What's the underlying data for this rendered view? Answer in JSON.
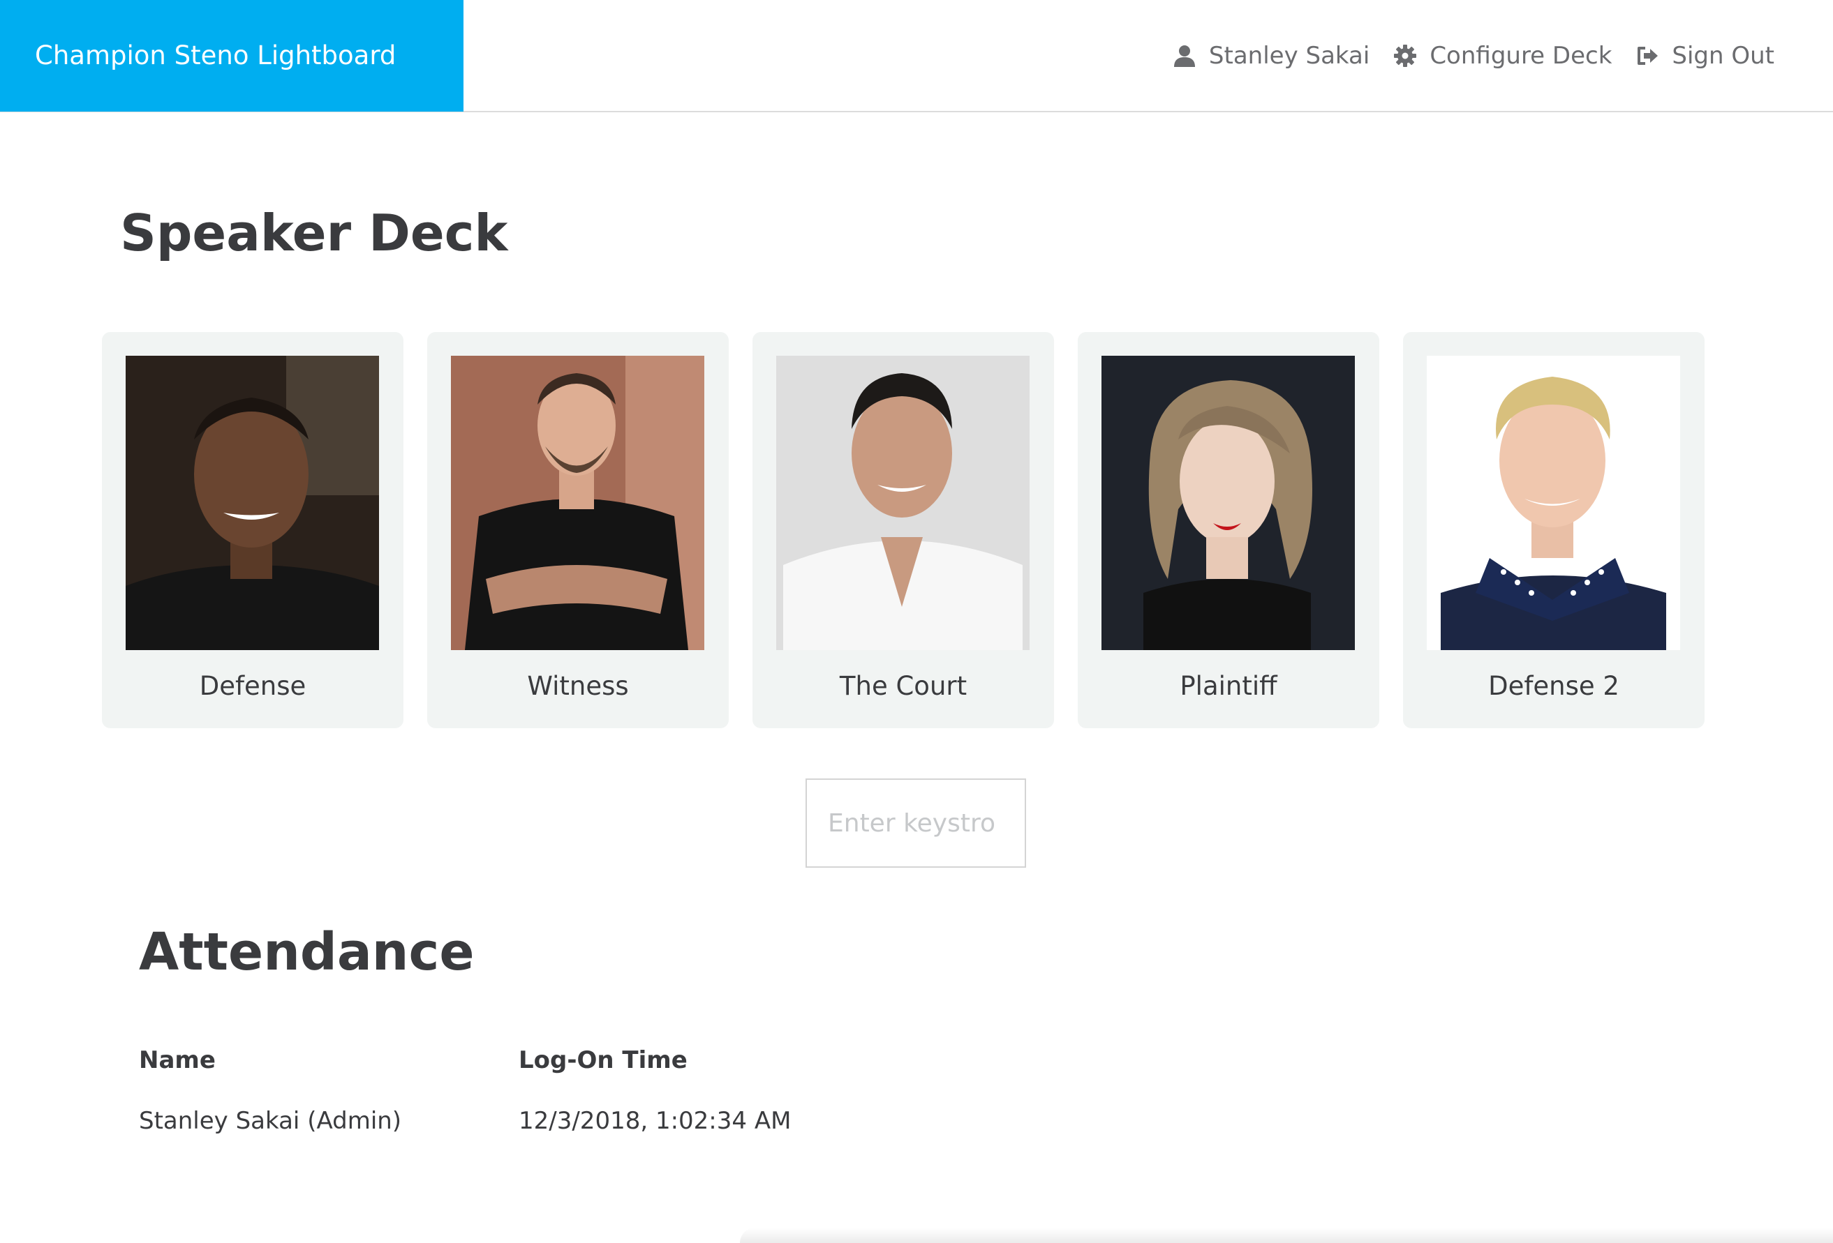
{
  "header": {
    "brand": "Champion Steno Lightboard",
    "brand_color": "#00aef0",
    "nav": [
      {
        "icon": "user-icon",
        "label": "Stanley Sakai"
      },
      {
        "icon": "gear-icon",
        "label": "Configure Deck"
      },
      {
        "icon": "sign-out-icon",
        "label": "Sign Out"
      }
    ]
  },
  "speaker_deck": {
    "title": "Speaker Deck",
    "cards": [
      {
        "label": "Defense",
        "photo": "portrait-photo"
      },
      {
        "label": "Witness",
        "photo": "portrait-photo"
      },
      {
        "label": "The Court",
        "photo": "portrait-photo"
      },
      {
        "label": "Plaintiff",
        "photo": "portrait-photo"
      },
      {
        "label": "Defense 2",
        "photo": "portrait-photo"
      }
    ]
  },
  "keystroke_input": {
    "placeholder": "Enter keystro",
    "value": ""
  },
  "attendance": {
    "title": "Attendance",
    "columns": [
      "Name",
      "Log-On Time"
    ],
    "rows": [
      {
        "name": "Stanley Sakai (Admin)",
        "time": "12/3/2018, 1:02:34 AM"
      }
    ]
  }
}
